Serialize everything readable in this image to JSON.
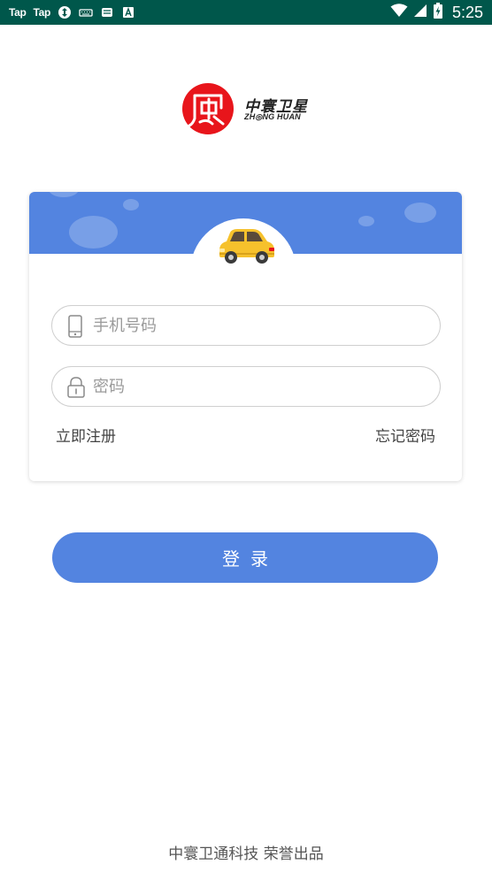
{
  "status_bar": {
    "left_labels": [
      "Tap",
      "Tap"
    ],
    "icons": [
      "refresh-icon",
      "keyboard-icon",
      "message-icon",
      "a-app-icon"
    ],
    "right_icons": [
      "wifi-icon",
      "signal-icon",
      "battery-icon"
    ],
    "time": "5:25"
  },
  "brand": {
    "name_cn": "中寰卫星",
    "name_en": "ZH◎NG HUAN",
    "color": "#e8151b"
  },
  "login": {
    "phone_placeholder": "手机号码",
    "password_placeholder": "密码",
    "register_link": "立即注册",
    "forgot_link": "忘记密码",
    "submit_label": "登录"
  },
  "footer": {
    "text": "中寰卫通科技 荣誉出品"
  },
  "colors": {
    "accent": "#5384e0",
    "status_bar": "#00574b",
    "car": "#f6c12c"
  }
}
